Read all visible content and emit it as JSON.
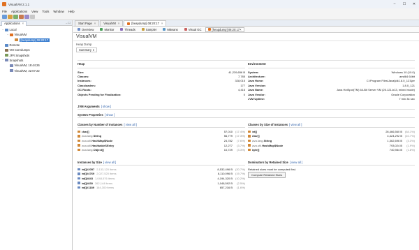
{
  "window": {
    "title": "VisualVM 2.1.1"
  },
  "menu": [
    "File",
    "Applications",
    "View",
    "Tools",
    "Window",
    "Help"
  ],
  "colors": {
    "accent": "#3c7fd0",
    "brand": "#e07020",
    "link": "#2b5ea8"
  },
  "left": {
    "tab": "Applications",
    "tree": [
      {
        "label": "Local",
        "level": 0,
        "toggle": "−",
        "icon": "local-host-icon"
      },
      {
        "label": "VisualVM",
        "level": 1,
        "toggle": "−",
        "icon": "visualvm-icon"
      },
      {
        "label": "[heapdump] 08:20:17",
        "level": 2,
        "toggle": "",
        "icon": "heapdump-icon",
        "selected": true
      },
      {
        "label": "Remote",
        "level": 0,
        "toggle": "",
        "icon": "remote-icon"
      },
      {
        "label": "VM Coredumps",
        "level": 0,
        "toggle": "",
        "icon": "coredump-icon"
      },
      {
        "label": "JFR Snapshots",
        "level": 0,
        "toggle": "",
        "icon": "jfr-icon"
      },
      {
        "label": "Snapshots",
        "level": 0,
        "toggle": "−",
        "icon": "snapshots-icon"
      },
      {
        "label": "VisualVM, 19:44:26",
        "level": 1,
        "toggle": "",
        "icon": "snapshot-icon"
      },
      {
        "label": "VisualVM, 22:07:22",
        "level": 1,
        "toggle": "",
        "icon": "snapshot-icon"
      }
    ]
  },
  "doctabs": [
    {
      "label": "Start Page",
      "active": false
    },
    {
      "label": "VisualVM",
      "active": false
    },
    {
      "label": "[heapdump] 08:20:17",
      "active": true
    }
  ],
  "subtabs": [
    {
      "label": "Overview",
      "color": "#6b8cc8"
    },
    {
      "label": "Monitor",
      "color": "#4aa05a"
    },
    {
      "label": "Threads",
      "color": "#8a6cb8"
    },
    {
      "label": "Sampler",
      "color": "#c8a040"
    },
    {
      "label": "MBeans",
      "color": "#5a98c8"
    },
    {
      "label": "Visual GC",
      "color": "#c86060"
    },
    {
      "label": "[heapdump] 08:20:17",
      "color": "#e07020",
      "active": true
    }
  ],
  "content": {
    "title": "VisualVM",
    "subtitle": "Heap Dump",
    "view": "Summary",
    "heap": {
      "title": "Heap",
      "rows": [
        {
          "k": "Size:",
          "v": "41,239,656 B"
        },
        {
          "k": "Classes:",
          "v": "7,785"
        },
        {
          "k": "Instances:",
          "v": "328,015"
        },
        {
          "k": "Classloaders:",
          "v": "177"
        },
        {
          "k": "GC Roots:",
          "v": "4,416"
        },
        {
          "k": "Objects Pending for Finalization:",
          "v": "0"
        }
      ]
    },
    "env": {
      "title": "Environment",
      "rows": [
        {
          "k": "System:",
          "v": "Windows 10 (10.0)"
        },
        {
          "k": "Architecture:",
          "v": "amd64 64bit"
        },
        {
          "k": "Java Home:",
          "v": "C:\\Program Files\\Java\\jdk1.8.0_121\\jre"
        },
        {
          "k": "Java Version:",
          "v": "1.8.0_121"
        },
        {
          "k": "Java Name:",
          "v": "Java HotSpot(TM) 64-Bit Server VM (25.121-b13, mixed mode)"
        },
        {
          "k": "Java Vendor:",
          "v": "Oracle Corporation"
        },
        {
          "k": "JVM Uptime:",
          "v": "7 min 34 sec"
        }
      ]
    },
    "jvm_args": {
      "label": "JVM Arguments",
      "show": "[ show ]"
    },
    "sys_props": {
      "label": "System Properties",
      "show": "[ show ]"
    },
    "by_instances": {
      "title": "Classes by Number of Instances",
      "view_all": "[ view all ]",
      "rows": [
        {
          "pkg": "",
          "name": "char[]",
          "count": "57,010",
          "pct": "(17.4%)"
        },
        {
          "pkg": "java.lang.",
          "name": "String",
          "count": "56,779",
          "pct": "(17.3%)"
        },
        {
          "pkg": "java.util.",
          "name": "HashMap$Node",
          "count": "24,782",
          "pct": "(7.6%)"
        },
        {
          "pkg": "java.util.",
          "name": "HashtableSEntry",
          "count": "12,277",
          "pct": "(3.7%)"
        },
        {
          "pkg": "java.lang.",
          "name": "Object[]",
          "count": "10,729",
          "pct": "(3.3%)"
        }
      ]
    },
    "by_size": {
      "title": "Classes by Size of Instances",
      "view_all": "[ view all ]",
      "rows": [
        {
          "pkg": "",
          "name": "int[]",
          "count": "26,466,560 B",
          "pct": "(64.1%)"
        },
        {
          "pkg": "",
          "name": "char[]",
          "count": "4,424,292 B",
          "pct": "(10.7%)"
        },
        {
          "pkg": "java.lang.",
          "name": "String",
          "count": "1,362,696 B",
          "pct": "(3.3%)"
        },
        {
          "pkg": "java.util.",
          "name": "HashMap$Node",
          "count": "793,024 B",
          "pct": "(1.9%)"
        },
        {
          "pkg": "",
          "name": "byte[]",
          "count": "740,984 B",
          "pct": "(1.8%)"
        }
      ]
    },
    "inst_by_size": {
      "title": "Instances by Size",
      "view_all": "[ view all ]",
      "rows": [
        {
          "name": "int[]#2057",
          "items": "2,133,120 items",
          "count": "8,532,496 B",
          "pct": "(20.7%)"
        },
        {
          "name": "int[]#4769",
          "items": "2,027,520 items",
          "count": "8,110,096 B",
          "pct": "(19.7%)"
        },
        {
          "name": "int[]#843",
          "items": "1,048,576 items",
          "count": "4,194,320 B",
          "pct": "(10.2%)"
        },
        {
          "name": "int[]#830",
          "items": "262,144 items",
          "count": "1,048,592 B",
          "pct": "(2.5%)"
        },
        {
          "name": "int[]#1189",
          "items": "164,300 items",
          "count": "657,216 B",
          "pct": "(1.6%)"
        }
      ]
    },
    "dominators": {
      "title": "Dominators by Retained Size",
      "view_all": "[ view all ]",
      "note": "Retained sizes must be computed first.",
      "button": "Compute Retained Sizes"
    }
  }
}
